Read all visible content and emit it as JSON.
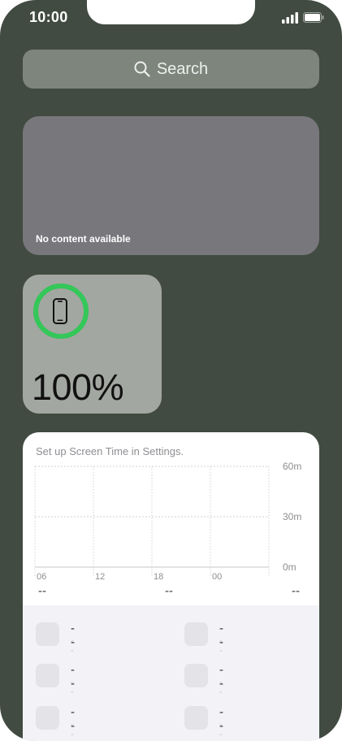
{
  "status_bar": {
    "time": "10:00"
  },
  "search": {
    "placeholder": "Search"
  },
  "empty_widget": {
    "message": "No content available"
  },
  "battery_widget": {
    "percent_label": "100%",
    "level": 1.0,
    "ring_color": "#34c759"
  },
  "screen_time": {
    "title": "Set up Screen Time in Settings.",
    "chart_data": {
      "type": "bar",
      "categories": [
        "06",
        "12",
        "18",
        "00"
      ],
      "values": [],
      "y_ticks": [
        "60m",
        "30m",
        "0m"
      ],
      "ylim": [
        0,
        60
      ],
      "grid": true
    },
    "summary": [
      "--",
      "--",
      "--"
    ],
    "apps": [
      {
        "name": "--",
        "sub": "--"
      },
      {
        "name": "--",
        "sub": "--"
      },
      {
        "name": "--",
        "sub": "--"
      },
      {
        "name": "--",
        "sub": "--"
      },
      {
        "name": "--",
        "sub": "--"
      },
      {
        "name": "--",
        "sub": "--"
      }
    ]
  }
}
